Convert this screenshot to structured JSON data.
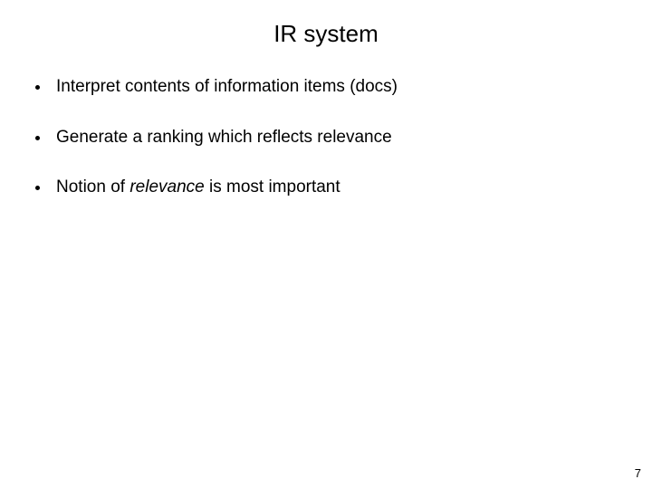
{
  "title": "IR system",
  "bullets": [
    {
      "plain": "Interpret contents of information items (docs)"
    },
    {
      "plain": "Generate a ranking which reflects relevance"
    },
    {
      "pre": "Notion of ",
      "italic": "relevance",
      "post": " is most important"
    }
  ],
  "page_number": "7"
}
